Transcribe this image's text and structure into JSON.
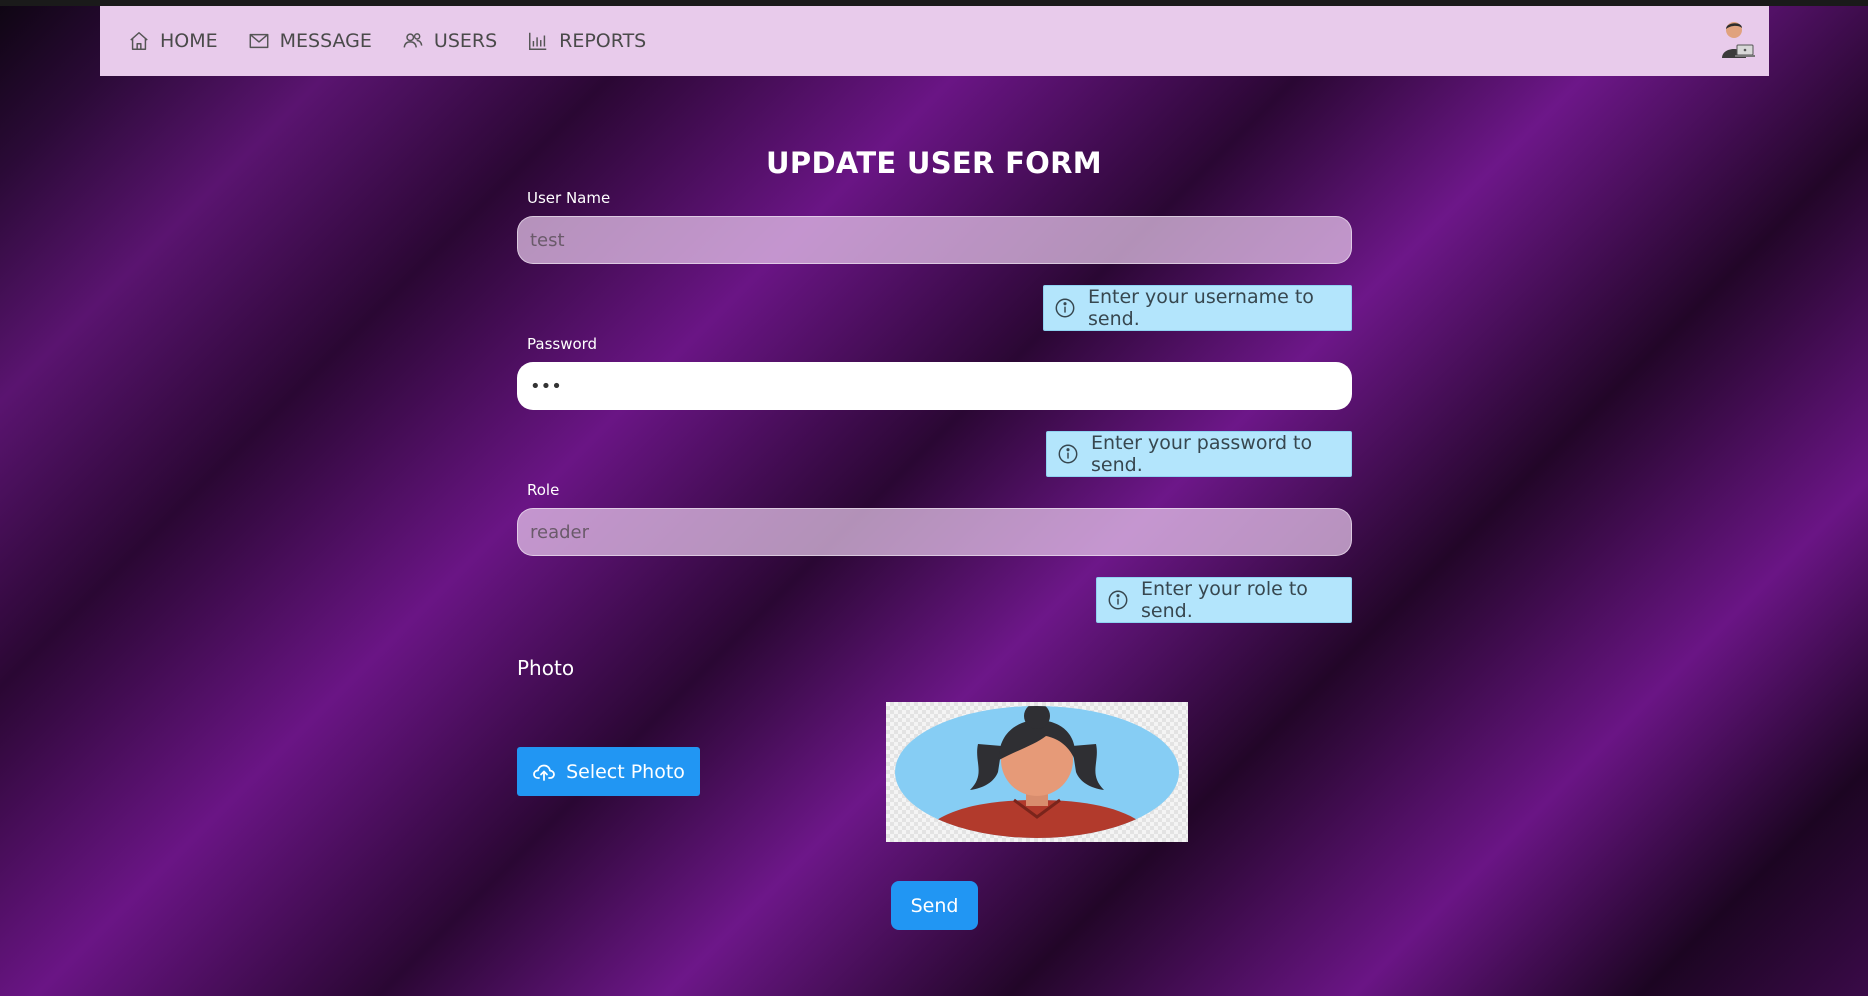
{
  "nav": {
    "items": [
      {
        "label": "HOME",
        "icon": "home-icon"
      },
      {
        "label": "MESSAGE",
        "icon": "envelope-icon"
      },
      {
        "label": "USERS",
        "icon": "users-icon"
      },
      {
        "label": "REPORTS",
        "icon": "bar-chart-icon"
      }
    ],
    "avatar": "user-avatar-icon"
  },
  "form": {
    "title": "UPDATE USER FORM",
    "username": {
      "label": "User Name",
      "value": "test",
      "hint": "Enter your username to send."
    },
    "password": {
      "label": "Password",
      "value": "•••",
      "hint": "Enter your password to send."
    },
    "role": {
      "label": "Role",
      "value": "reader",
      "hint": "Enter your role to send."
    },
    "photo": {
      "label": "Photo",
      "select_label": "Select Photo",
      "select_icon": "cloud-upload-icon"
    },
    "send_label": "Send"
  },
  "colors": {
    "navbar_bg": "#e8cbeb",
    "hint_bg": "#b3e5fc",
    "button_primary": "#2196f3",
    "background_purple": "#6a1585"
  }
}
